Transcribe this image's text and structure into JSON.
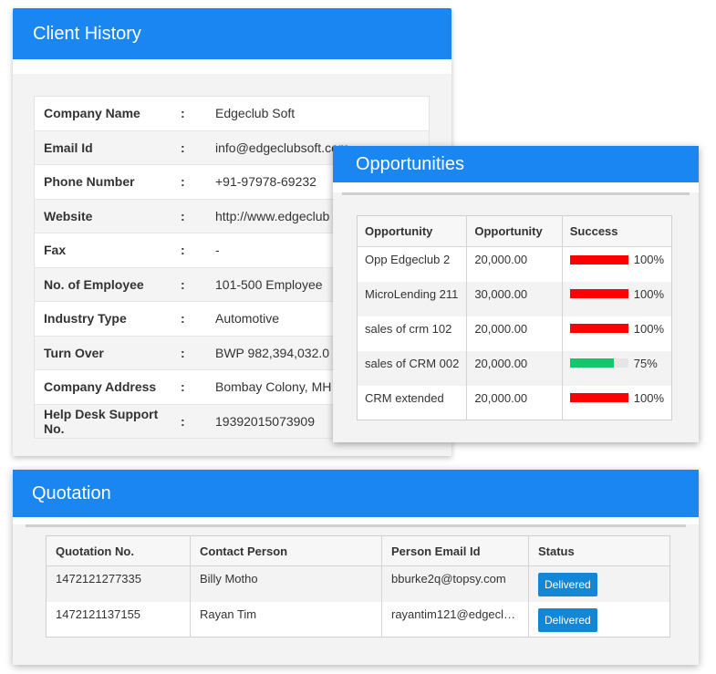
{
  "client": {
    "title": "Client History",
    "rows": [
      {
        "label": "Company Name",
        "sep": ":",
        "value": "Edgeclub Soft"
      },
      {
        "label": "Email Id",
        "sep": ":",
        "value": "info@edgeclubsoft.com"
      },
      {
        "label": "Phone Number",
        "sep": ":",
        "value": "+91-97978-69232"
      },
      {
        "label": "Website",
        "sep": ":",
        "value": "http://www.edgeclub"
      },
      {
        "label": "Fax",
        "sep": ":",
        "value": "-"
      },
      {
        "label": "No. of Employee",
        "sep": ":",
        "value": "101-500 Employee"
      },
      {
        "label": "Industry Type",
        "sep": ":",
        "value": "Automotive"
      },
      {
        "label": "Turn Over",
        "sep": ":",
        "value": "BWP 982,394,032.0"
      },
      {
        "label": "Company Address",
        "sep": ":",
        "value": "Bombay Colony, MH"
      },
      {
        "label": "Help Desk Support No.",
        "sep": ":",
        "value": "19392015073909"
      }
    ]
  },
  "opportunities": {
    "title": "Opportunities",
    "headers": [
      "Opportunity",
      "Opportunity",
      "Success"
    ],
    "rows": [
      {
        "name": "Opp Edgeclub 2",
        "amount": "20,000.00",
        "success": "100%",
        "pct": 100,
        "color": "#ff0000"
      },
      {
        "name": "MicroLending 211",
        "amount": "30,000.00",
        "success": "100%",
        "pct": 100,
        "color": "#ff0000"
      },
      {
        "name": "sales of crm 102",
        "amount": "20,000.00",
        "success": "100%",
        "pct": 100,
        "color": "#ff0000"
      },
      {
        "name": "sales of CRM 002",
        "amount": "20,000.00",
        "success": "75%",
        "pct": 75,
        "color": "#17c56c"
      },
      {
        "name": "CRM extended",
        "amount": "20,000.00",
        "success": "100%",
        "pct": 100,
        "color": "#ff0000"
      }
    ]
  },
  "quotation": {
    "title": "Quotation",
    "headers": [
      "Quotation No.",
      "Contact Person",
      "Person Email Id",
      "Status"
    ],
    "rows": [
      {
        "number": "1472121277335",
        "contact": "Billy Motho",
        "email": "bburke2q@topsy.com",
        "status": "Delivered"
      },
      {
        "number": "1472121137155",
        "contact": "Rayan Tim",
        "email": "rayantim121@edgeclu…",
        "status": "Delivered"
      }
    ]
  }
}
